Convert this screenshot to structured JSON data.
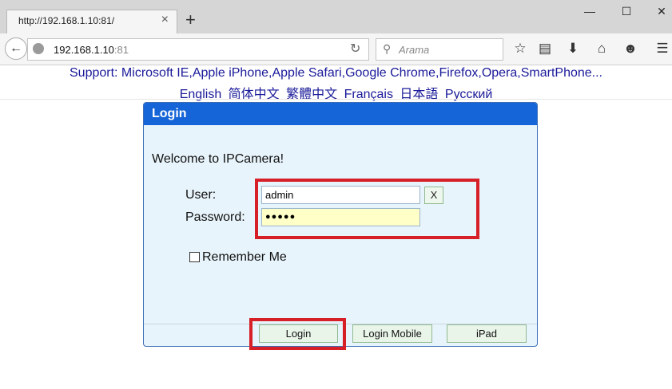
{
  "browser": {
    "tab_title": "http://192.168.1.10:81/",
    "tab_close": "×",
    "new_tab": "+",
    "minimize": "—",
    "maximize": "☐",
    "close": "✕",
    "url_host": "192.168.1.10",
    "url_port": ":81",
    "search_placeholder": "Arama",
    "icons": [
      "back-icon",
      "globe-icon",
      "reload-icon",
      "search-icon",
      "star-icon",
      "reader-icon",
      "download-icon",
      "home-icon",
      "smiley-icon",
      "menu-icon"
    ]
  },
  "page": {
    "support_text": "Support: Microsoft IE,Apple iPhone,Apple Safari,Google Chrome,Firefox,Opera,SmartPhone...",
    "languages": [
      "English",
      "简体中文",
      "繁體中文",
      "Français",
      "日本語",
      "Русский"
    ],
    "login_panel": {
      "title": "Login",
      "welcome": "Welcome to IPCamera!",
      "user_label": "User:",
      "user_value": "admin",
      "clear_label": "X",
      "password_label": "Password:",
      "password_value": "●●●●●",
      "remember_label": "Remember Me",
      "buttons": {
        "login": "Login",
        "login_mobile": "Login Mobile",
        "ipad": "iPad"
      }
    }
  },
  "colors": {
    "panel_header": "#1565d8",
    "panel_bg": "#e8f4fb",
    "highlight": "#d61f26",
    "password_bg": "#ffffc8"
  }
}
